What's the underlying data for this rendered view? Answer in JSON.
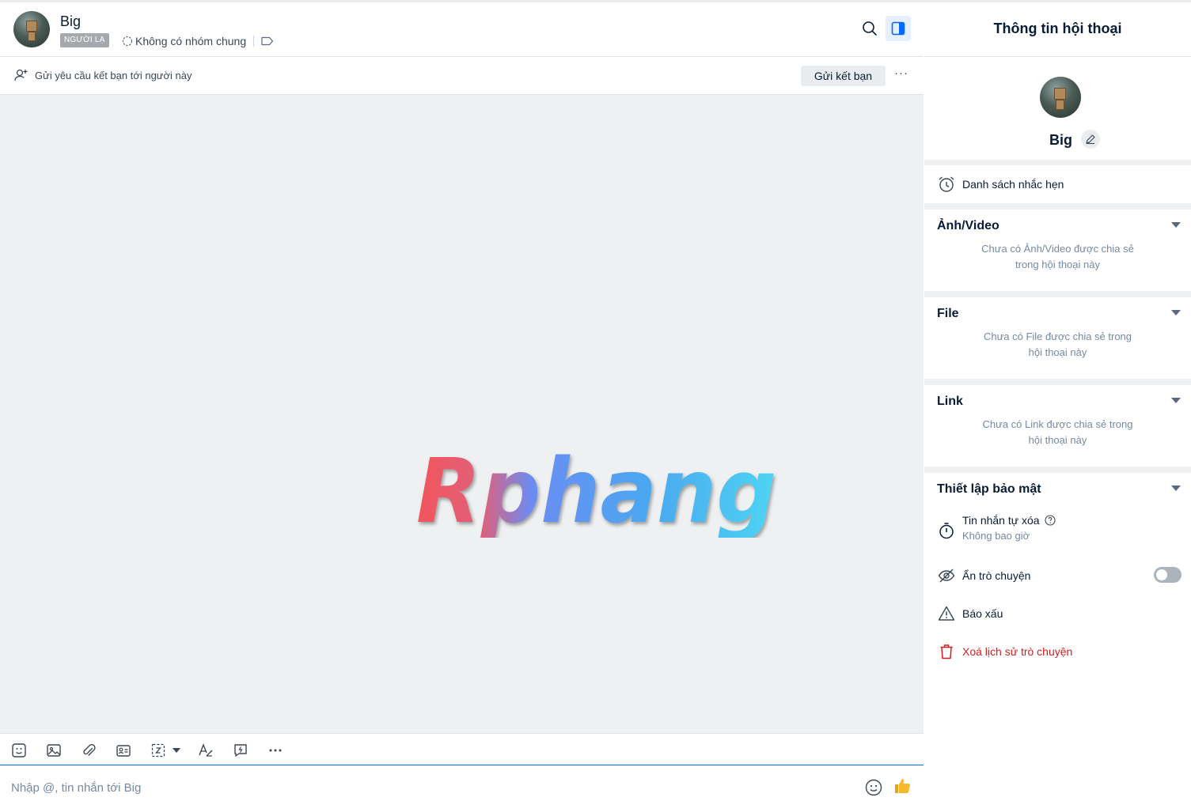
{
  "header": {
    "name": "Big",
    "badge": "NGƯỜI LẠ",
    "group_status": "Không có nhóm chung"
  },
  "friend_bar": {
    "message": "Gửi yêu cầu kết bạn tới người này",
    "button": "Gửi kết bạn",
    "more": "···"
  },
  "composer": {
    "placeholder": "Nhập @, tin nhắn tới Big"
  },
  "panel": {
    "title": "Thông tin hội thoại",
    "name": "Big",
    "reminders": "Danh sách nhắc hẹn",
    "media": {
      "title": "Ảnh/Video",
      "empty_line1": "Chưa có Ảnh/Video được chia sẻ",
      "empty_line2": "trong hội thoại này"
    },
    "file": {
      "title": "File",
      "empty_line1": "Chưa có File được chia sẻ trong",
      "empty_line2": "hội thoại này"
    },
    "link": {
      "title": "Link",
      "empty_line1": "Chưa có Link được chia sẻ trong",
      "empty_line2": "hội thoại này"
    },
    "security": {
      "title": "Thiết lập bảo mật",
      "self_destruct": "Tin nhắn tự xóa",
      "self_destruct_value": "Không bao giờ",
      "hide_chat": "Ẩn trò chuyện",
      "hide_chat_enabled": false,
      "report": "Báo xấu",
      "delete_history": "Xoá lịch sử trò chuyện"
    }
  },
  "colors": {
    "accent": "#0068ff",
    "danger": "#d91b1b",
    "muted": "#7589a3"
  }
}
